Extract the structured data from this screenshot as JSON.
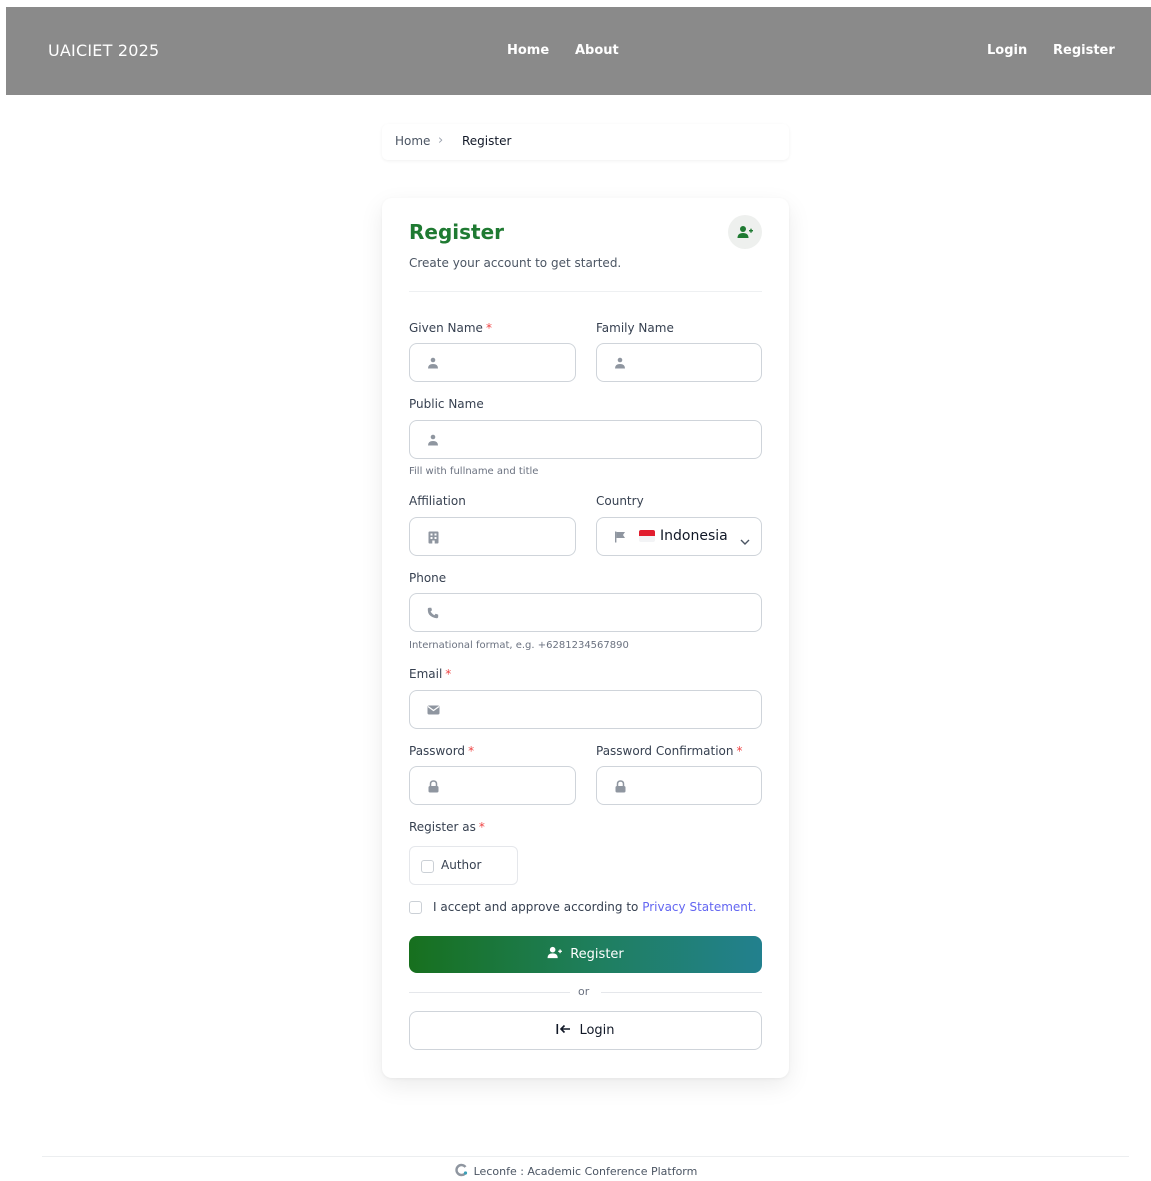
{
  "navbar": {
    "brand": "UAICIET 2025",
    "links": [
      {
        "label": "Home"
      },
      {
        "label": "About"
      }
    ],
    "auth": {
      "login": "Login",
      "register": "Register"
    }
  },
  "breadcrumb": {
    "home": "Home",
    "current": "Register"
  },
  "form": {
    "title": "Register",
    "subtitle": "Create your account to get started.",
    "given_name": {
      "label": "Given Name",
      "value": ""
    },
    "family_name": {
      "label": "Family Name",
      "value": ""
    },
    "public_name": {
      "label": "Public Name",
      "value": "",
      "hint": "Fill with fullname and title"
    },
    "affiliation": {
      "label": "Affiliation",
      "value": ""
    },
    "country": {
      "label": "Country",
      "selected": "Indonesia"
    },
    "phone": {
      "label": "Phone",
      "value": "",
      "hint": "International format, e.g. +6281234567890"
    },
    "email": {
      "label": "Email",
      "value": ""
    },
    "password": {
      "label": "Password",
      "value": ""
    },
    "password_confirmation": {
      "label": "Password Confirmation",
      "value": ""
    },
    "register_as": {
      "label": "Register as",
      "options": [
        {
          "label": "Author",
          "checked": false
        }
      ]
    },
    "accept": {
      "text": "I accept and approve according to",
      "link": "Privacy Statement."
    },
    "required_mark": "*",
    "register_button": "Register",
    "or": "or",
    "login_button": "Login"
  },
  "footer": {
    "text": "Leconfe : Academic Conference Platform"
  },
  "colors": {
    "navbar": "#8a8a8a",
    "title": "#1f7a32",
    "required": "#ef4444",
    "link": "#6366f1",
    "gradient_start": "#17701e",
    "gradient_end": "#22808e"
  },
  "icons": [
    "user-plus-icon",
    "user-icon",
    "building-icon",
    "flag-icon",
    "phone-icon",
    "envelope-icon",
    "lock-icon",
    "chevron-down-icon",
    "login-arrow-icon",
    "leconfe-logo-icon"
  ]
}
